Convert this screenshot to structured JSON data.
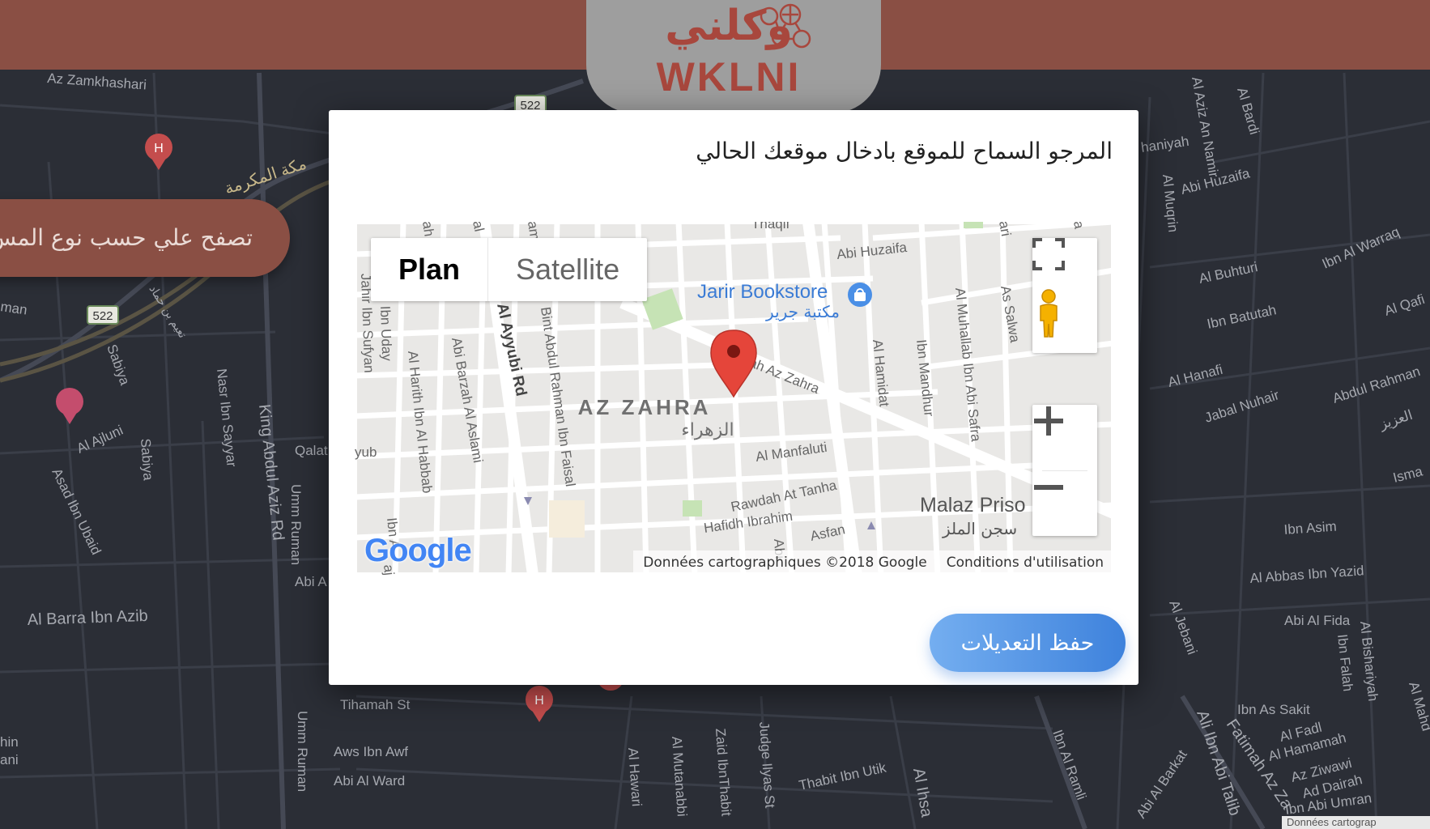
{
  "header": {
    "logo_ar": "وكلني",
    "logo_en": "WKLNI"
  },
  "browse_button": {
    "label": "تصفح علي حسب نوع المس"
  },
  "background_map": {
    "road_shields": [
      "522",
      "522"
    ],
    "labels": [
      "Az Zamkhashari",
      "مكة المكرمة",
      "man",
      "Sabiya",
      "Nasr Ibn Sayyar",
      "King Abdul Aziz Rd",
      "Al Ajluni",
      "Asad Ibn Ubaid",
      "Sabiya",
      "Qalat",
      "Umm Ruman",
      "Abi A",
      "Al Barra Ibn Azib",
      "Tihamah St",
      "Umm Ruman",
      "Aws Ibn Awf",
      "Abi Al Ward",
      "hin",
      "ani",
      "Al Hawari",
      "Al Mutanabbi",
      "Zaid IbnThabit",
      "Judge Ilyas St",
      "Thabit Ibn Utik",
      "Al Ihsa",
      "Ibn Al Ramli",
      "Abi Al Barkat",
      "Ali Ibn Abi Talib",
      "Fatimah Az Za",
      "Az Ziwawi",
      "Ad Dairah",
      "Ibn Abi Umran",
      "Ibn As Sakit",
      "Al Fadl",
      "Al Hamamah",
      "Abi Al Fida",
      "Ibn Falah",
      "Al Bishariyah",
      "Al Abbas Ibn Yazid",
      "Ibn Asim",
      "Isma",
      "Al Mahd",
      "Al Jebani",
      "Abdul Rahman",
      "Jabal Nuhair",
      "Al Hanafi",
      "Ibn Batutah",
      "Al Buhturi",
      "Ibn Al Warraq",
      "Al Qafi",
      "Abi Huzaifa",
      "Al Muqrin",
      "Al Bardi",
      "Al Aziz An Namir",
      "haniyah",
      "العزيز",
      "تعيم بن حماد",
      "Al Ajlu"
    ],
    "credit": "Données cartograp"
  },
  "modal": {
    "title": "المرجو السماح للموقع بادخال موقعك الحالي",
    "map": {
      "map_type": {
        "plan": "Plan",
        "satellite": "Satellite",
        "selected": "Plan"
      },
      "district": "AZ ZAHRA",
      "district_ar": "الزهراء",
      "poi_name": "Jarir Bookstore",
      "poi_name_ar": "مكتبة جرير",
      "prison": "Malaz Priso",
      "prison_ar": "سجن الملز",
      "streets": [
        "Thaqif",
        "Abi Huzaifa",
        "Al Muhallab Ibn Abi Safra",
        "As Salwa",
        "Ibn Mandhur",
        "Al Hamidat",
        "ah Az Zahra",
        "Al Manfaluti",
        "Rawdah At Tanha",
        "Hafidh Ibrahim",
        "Asfan",
        "Abi",
        "Jahir Ibn Sufyan",
        "Ibn Uday",
        "Al Harith Ibn Al Habbab",
        "Abi Barzah Al Aslami",
        "Al Ayyubi Rd",
        "Bint Abdul Rahman Ibn Faisal",
        "yub",
        "Ibn A",
        "al",
        "ah",
        "am",
        "ari",
        "a",
        "ajs"
      ],
      "logo": "Google",
      "footer": {
        "data": "Données cartographiques ©2018 Google",
        "terms": "Conditions d'utilisation"
      }
    },
    "save_button": "حفظ التعديلات"
  },
  "colors": {
    "topbar": "#8a4f44",
    "logo_bg": "#9e9e9e",
    "logo_text": "#a8473d",
    "background_map": "#2b2e36",
    "save_button_start": "#74aef0",
    "save_button_end": "#3e82dc",
    "marker": "#e5453a"
  }
}
